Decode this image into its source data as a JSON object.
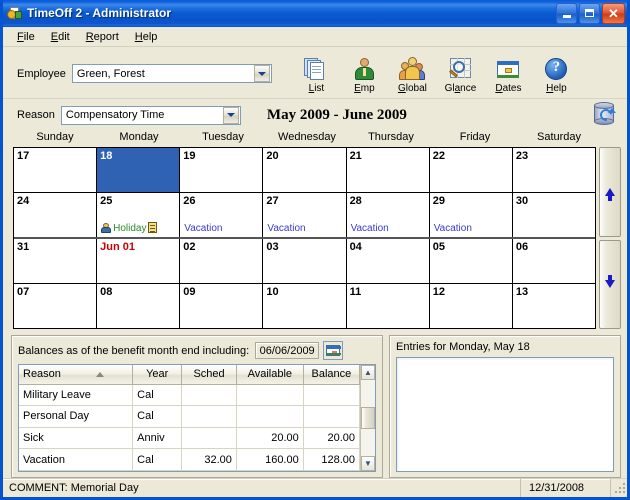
{
  "window": {
    "title": "TimeOff 2 - Administrator",
    "icon": "timeoff-app-icon",
    "controls": {
      "minimize": "–",
      "maximize": "□",
      "close": "✕"
    }
  },
  "menubar": [
    {
      "label": "File",
      "accel": "F"
    },
    {
      "label": "Edit",
      "accel": "E"
    },
    {
      "label": "Report",
      "accel": "R"
    },
    {
      "label": "Help",
      "accel": "H"
    }
  ],
  "toolbar": {
    "employee_label": "Employee",
    "employee_value": "Green, Forest",
    "buttons": [
      {
        "label": "List",
        "accel": "L",
        "icon": "documents-list-icon"
      },
      {
        "label": "Emp",
        "accel": "E",
        "icon": "single-person-icon"
      },
      {
        "label": "Global",
        "accel": "G",
        "icon": "group-people-icon"
      },
      {
        "label": "Glance",
        "accel": "a",
        "icon": "magnifier-grid-icon"
      },
      {
        "label": "Dates",
        "accel": "D",
        "icon": "window-dates-icon"
      },
      {
        "label": "Help",
        "accel": "H",
        "icon": "help-question-icon"
      }
    ]
  },
  "reason_row": {
    "label": "Reason",
    "value": "Compensatory Time",
    "month_title": "May 2009 - June 2009",
    "refresh_icon": "database-refresh-icon"
  },
  "calendar": {
    "day_headers": [
      "Sunday",
      "Monday",
      "Tuesday",
      "Wednesday",
      "Thursday",
      "Friday",
      "Saturday"
    ],
    "weeks": [
      {
        "thick_bottom": false,
        "days": [
          {
            "num": "17",
            "selected": false,
            "entry": "",
            "entry_type": ""
          },
          {
            "num": "18",
            "selected": true,
            "entry": "",
            "entry_type": ""
          },
          {
            "num": "19",
            "selected": false,
            "entry": "",
            "entry_type": ""
          },
          {
            "num": "20",
            "selected": false,
            "entry": "",
            "entry_type": ""
          },
          {
            "num": "21",
            "selected": false,
            "entry": "",
            "entry_type": ""
          },
          {
            "num": "22",
            "selected": false,
            "entry": "",
            "entry_type": ""
          },
          {
            "num": "23",
            "selected": false,
            "entry": "",
            "entry_type": ""
          }
        ]
      },
      {
        "thick_bottom": true,
        "days": [
          {
            "num": "24",
            "selected": false,
            "entry": "",
            "entry_type": ""
          },
          {
            "num": "25",
            "selected": false,
            "entry": "Holiday",
            "entry_type": "holiday"
          },
          {
            "num": "26",
            "selected": false,
            "entry": "Vacation",
            "entry_type": "vacation"
          },
          {
            "num": "27",
            "selected": false,
            "entry": "Vacation",
            "entry_type": "vacation"
          },
          {
            "num": "28",
            "selected": false,
            "entry": "Vacation",
            "entry_type": "vacation"
          },
          {
            "num": "29",
            "selected": false,
            "entry": "Vacation",
            "entry_type": "vacation"
          },
          {
            "num": "30",
            "selected": false,
            "entry": "",
            "entry_type": ""
          }
        ]
      },
      {
        "thick_bottom": false,
        "days": [
          {
            "num": "31",
            "selected": false,
            "red": false,
            "entry": "",
            "entry_type": ""
          },
          {
            "num": "Jun 01",
            "selected": false,
            "red": true,
            "entry": "",
            "entry_type": ""
          },
          {
            "num": "02",
            "selected": false,
            "entry": "",
            "entry_type": ""
          },
          {
            "num": "03",
            "selected": false,
            "entry": "",
            "entry_type": ""
          },
          {
            "num": "04",
            "selected": false,
            "entry": "",
            "entry_type": ""
          },
          {
            "num": "05",
            "selected": false,
            "entry": "",
            "entry_type": ""
          },
          {
            "num": "06",
            "selected": false,
            "entry": "",
            "entry_type": ""
          }
        ]
      },
      {
        "thick_bottom": false,
        "days": [
          {
            "num": "07",
            "selected": false,
            "entry": "",
            "entry_type": ""
          },
          {
            "num": "08",
            "selected": false,
            "entry": "",
            "entry_type": ""
          },
          {
            "num": "09",
            "selected": false,
            "entry": "",
            "entry_type": ""
          },
          {
            "num": "10",
            "selected": false,
            "entry": "",
            "entry_type": ""
          },
          {
            "num": "11",
            "selected": false,
            "entry": "",
            "entry_type": ""
          },
          {
            "num": "12",
            "selected": false,
            "entry": "",
            "entry_type": ""
          },
          {
            "num": "13",
            "selected": false,
            "entry": "",
            "entry_type": ""
          }
        ]
      }
    ],
    "scroll_up_icon": "scroll-up-arrow",
    "scroll_down_icon": "scroll-down-arrow"
  },
  "balances": {
    "heading": "Balances as of the benefit month end including:",
    "date_value": "06/06/2009",
    "date_picker_icon": "date-picker-icon",
    "columns": [
      "Reason",
      "Year",
      "Sched",
      "Available",
      "Balance"
    ],
    "sorted_column": "Reason",
    "rows": [
      {
        "reason": "Military Leave",
        "year": "Cal",
        "sched": "",
        "available": "",
        "balance": ""
      },
      {
        "reason": "Personal Day",
        "year": "Cal",
        "sched": "",
        "available": "",
        "balance": ""
      },
      {
        "reason": "Sick",
        "year": "Anniv",
        "sched": "",
        "available": "20.00",
        "balance": "20.00"
      },
      {
        "reason": "Vacation",
        "year": "Cal",
        "sched": "32.00",
        "available": "160.00",
        "balance": "128.00"
      }
    ]
  },
  "entries_panel": {
    "title": "Entries for Monday,  May 18",
    "items": []
  },
  "statusbar": {
    "comment": "COMMENT: Memorial Day",
    "date": "12/31/2008"
  },
  "colors": {
    "titlebar_blue": "#0a5ad8",
    "window_face": "#ece9d8",
    "selection_blue": "#2f62b3",
    "vacation_text": "#3a3ad0",
    "holiday_text": "#2b8a2b",
    "newmonth_text": "#cc0000"
  }
}
